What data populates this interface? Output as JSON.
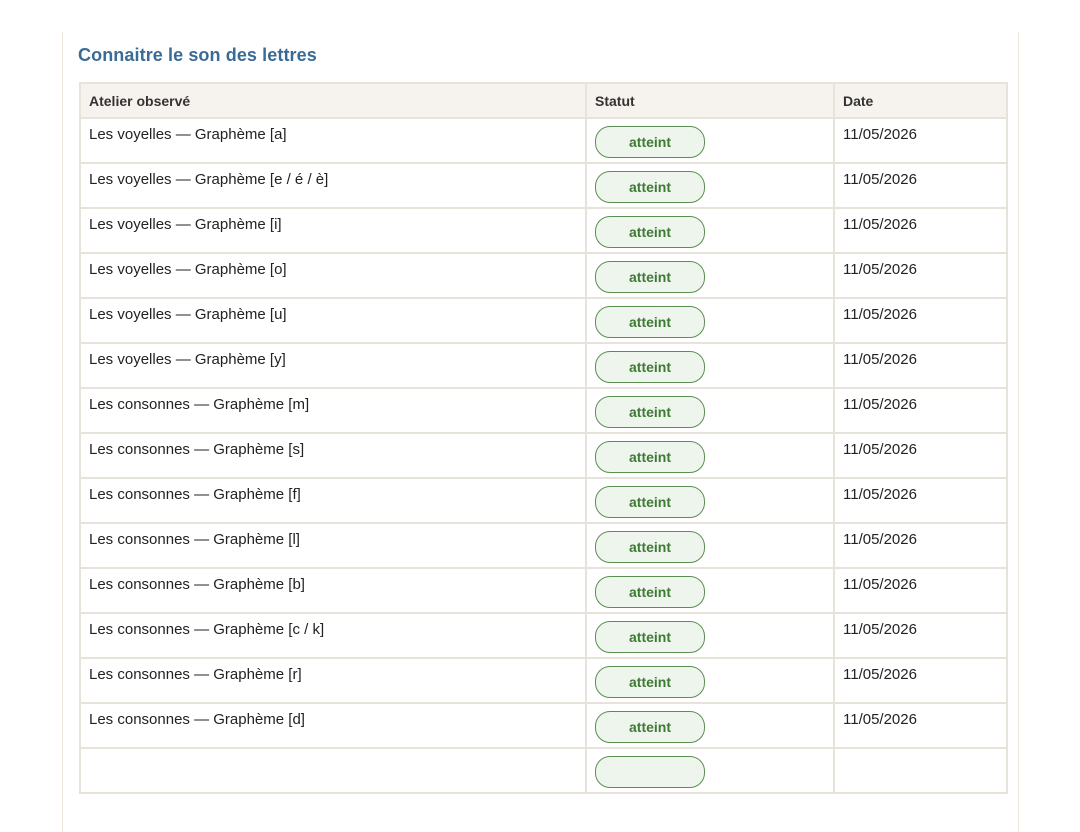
{
  "section": {
    "title": "Connaitre le son des lettres"
  },
  "table": {
    "headers": [
      "Atelier observé",
      "Statut",
      "Date"
    ],
    "rows": [
      {
        "atelier": "Les voyelles — Graphème [a]",
        "statut": "atteint",
        "date": "11/05/2026"
      },
      {
        "atelier": "Les voyelles — Graphème [e / é / è]",
        "statut": "atteint",
        "date": "11/05/2026"
      },
      {
        "atelier": "Les voyelles — Graphème [i]",
        "statut": "atteint",
        "date": "11/05/2026"
      },
      {
        "atelier": "Les voyelles — Graphème [o]",
        "statut": "atteint",
        "date": "11/05/2026"
      },
      {
        "atelier": "Les voyelles — Graphème [u]",
        "statut": "atteint",
        "date": "11/05/2026"
      },
      {
        "atelier": "Les voyelles — Graphème [y]",
        "statut": "atteint",
        "date": "11/05/2026"
      },
      {
        "atelier": "Les consonnes — Graphème [m]",
        "statut": "atteint",
        "date": "11/05/2026"
      },
      {
        "atelier": "Les consonnes — Graphème [s]",
        "statut": "atteint",
        "date": "11/05/2026"
      },
      {
        "atelier": "Les consonnes — Graphème [f]",
        "statut": "atteint",
        "date": "11/05/2026"
      },
      {
        "atelier": "Les consonnes — Graphème [l]",
        "statut": "atteint",
        "date": "11/05/2026"
      },
      {
        "atelier": "Les consonnes — Graphème [b]",
        "statut": "atteint",
        "date": "11/05/2026"
      },
      {
        "atelier": "Les consonnes — Graphème [c / k]",
        "statut": "atteint",
        "date": "11/05/2026"
      },
      {
        "atelier": "Les consonnes — Graphème [r]",
        "statut": "atteint",
        "date": "11/05/2026"
      },
      {
        "atelier": "Les consonnes — Graphème [d]",
        "statut": "atteint",
        "date": "11/05/2026"
      },
      {
        "atelier": "",
        "statut": "",
        "date": ""
      }
    ]
  },
  "colors": {
    "title": "#3a6b96",
    "status_border": "#5b8f52",
    "status_text": "#3f7a35",
    "header_bg": "#f6f3ee"
  }
}
